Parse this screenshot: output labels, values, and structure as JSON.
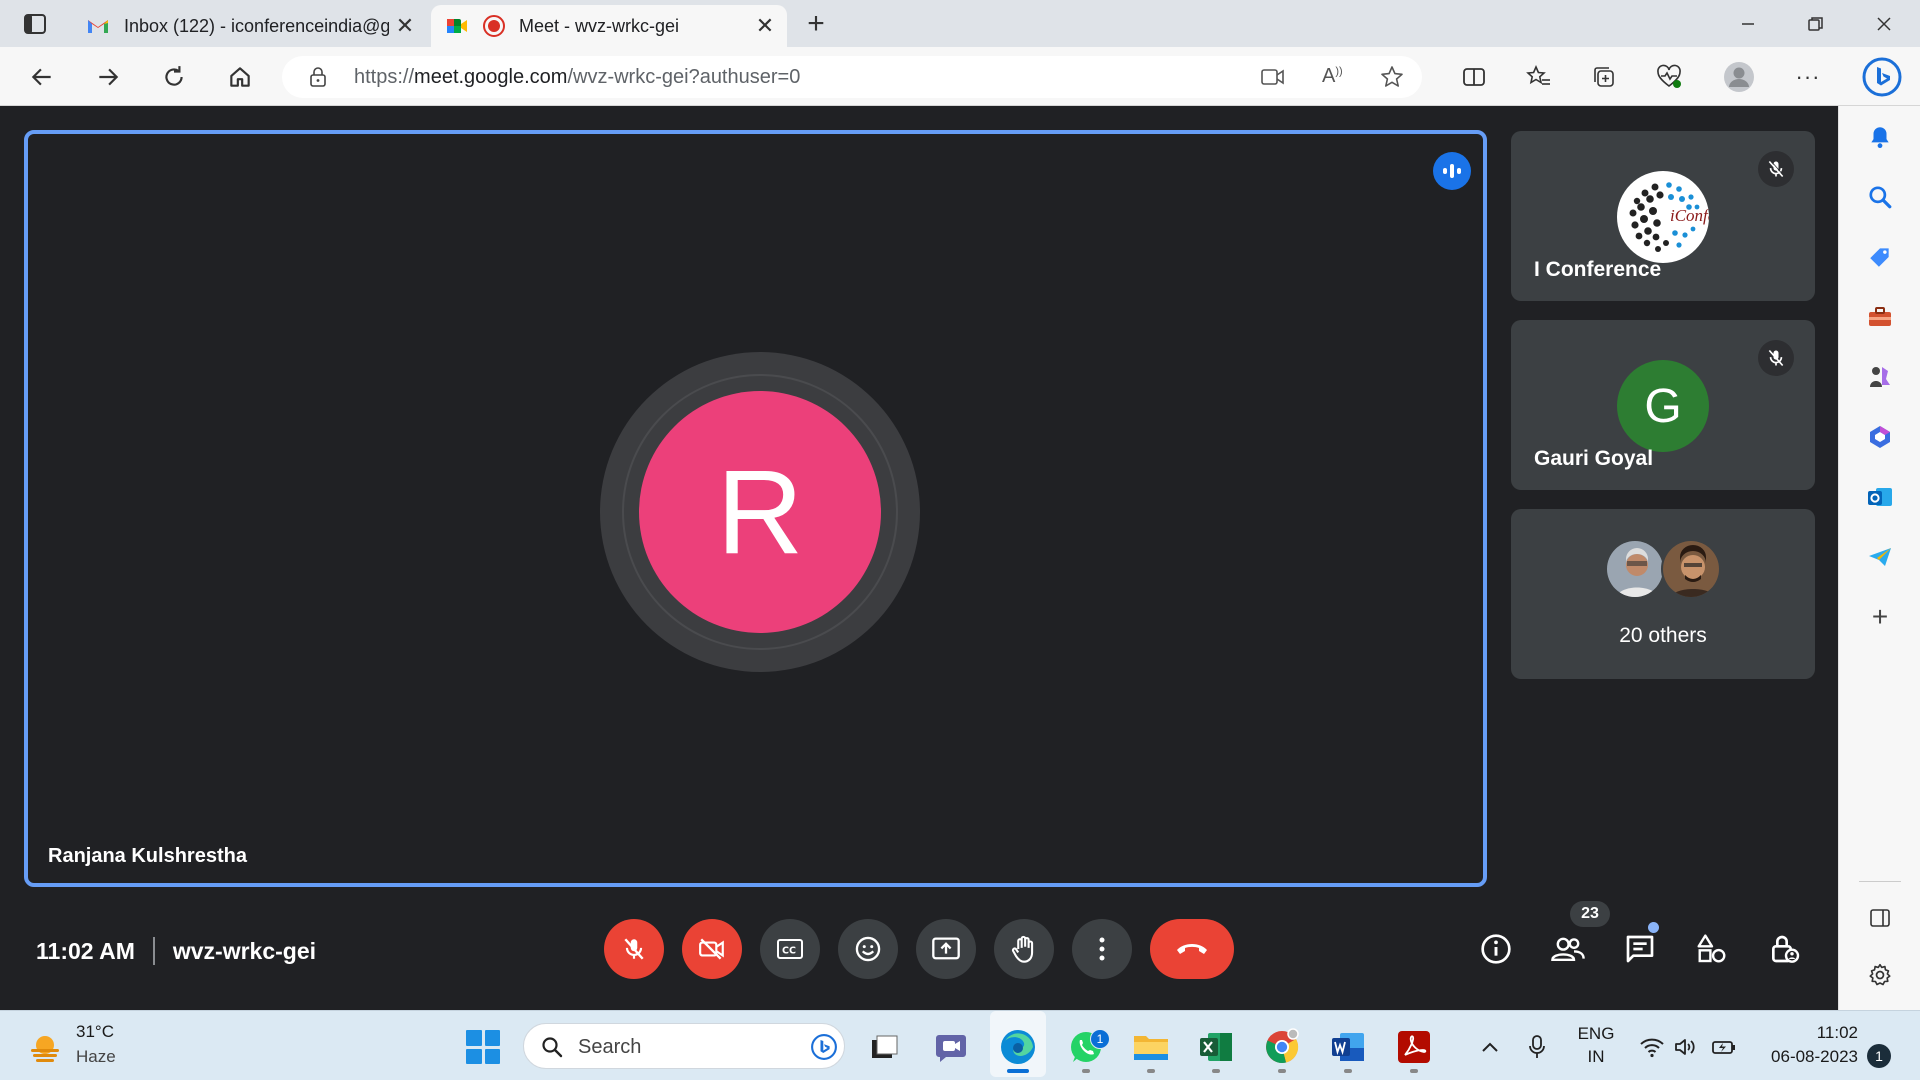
{
  "browser": {
    "tabs": [
      {
        "title": "Inbox (122) - iconferenceindia@g"
      },
      {
        "title": "Meet - wvz-wrkc-gei"
      }
    ],
    "url_prefix": "https://",
    "url_host": "meet.google.com",
    "url_path": "/wvz-wrkc-gei?authuser=0"
  },
  "meet": {
    "main_tile": {
      "initial": "R",
      "name": "Ranjana Kulshrestha",
      "avatar_color": "#ec407a"
    },
    "side_tiles": [
      {
        "name": "I Conference",
        "logo_text": "iConfer",
        "muted": true
      },
      {
        "name": "Gauri Goyal",
        "initial": "G",
        "avatar_color": "#2d7d32",
        "muted": true
      },
      {
        "others_label": "20 others"
      }
    ],
    "time": "11:02 AM",
    "meeting_code": "wvz-wrkc-gei",
    "participant_count": "23",
    "accent": "#669df6",
    "danger": "#ea4335"
  },
  "taskbar": {
    "weather_temp": "31°C",
    "weather_desc": "Haze",
    "search_label": "Search",
    "whatsapp_badge": "1",
    "lang_top": "ENG",
    "lang_bottom": "IN",
    "clock_time": "11:02",
    "clock_date": "06-08-2023",
    "notification_count": "1"
  }
}
